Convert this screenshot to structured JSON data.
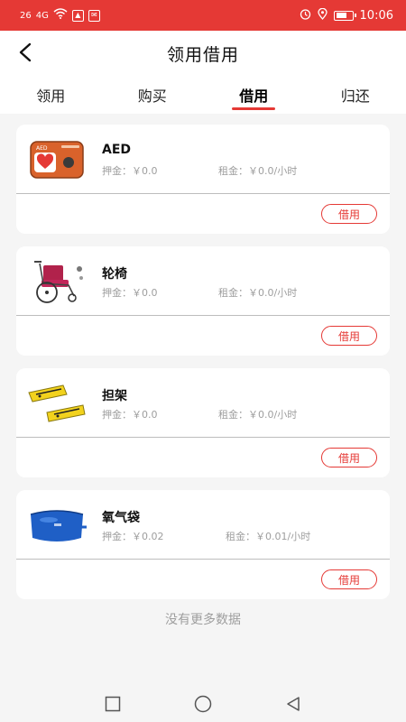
{
  "status_bar": {
    "signal_1": "26",
    "signal_2": "4G",
    "time": "10:06"
  },
  "header": {
    "title": "领用借用",
    "back_icon": "back-arrow-icon"
  },
  "tabs": [
    {
      "label": "领用",
      "active": false
    },
    {
      "label": "购买",
      "active": false
    },
    {
      "label": "借用",
      "active": true
    },
    {
      "label": "归还",
      "active": false
    }
  ],
  "items": [
    {
      "name": "AED",
      "deposit": "押金：￥0.0",
      "rent": "租金：￥0.0/小时",
      "button": "借用",
      "image": "aed-image"
    },
    {
      "name": "轮椅",
      "deposit": "押金：￥0.0",
      "rent": "租金：￥0.0/小时",
      "button": "借用",
      "image": "wheelchair-image"
    },
    {
      "name": "担架",
      "deposit": "押金：￥0.0",
      "rent": "租金：￥0.0/小时",
      "button": "借用",
      "image": "stretcher-image"
    },
    {
      "name": "氧气袋",
      "deposit": "押金：￥0.02",
      "rent": "租金：￥0.01/小时",
      "button": "借用",
      "image": "oxygen-bag-image"
    }
  ],
  "footer": {
    "no_more": "没有更多数据"
  },
  "colors": {
    "accent": "#e53935",
    "background": "#f5f5f5"
  }
}
